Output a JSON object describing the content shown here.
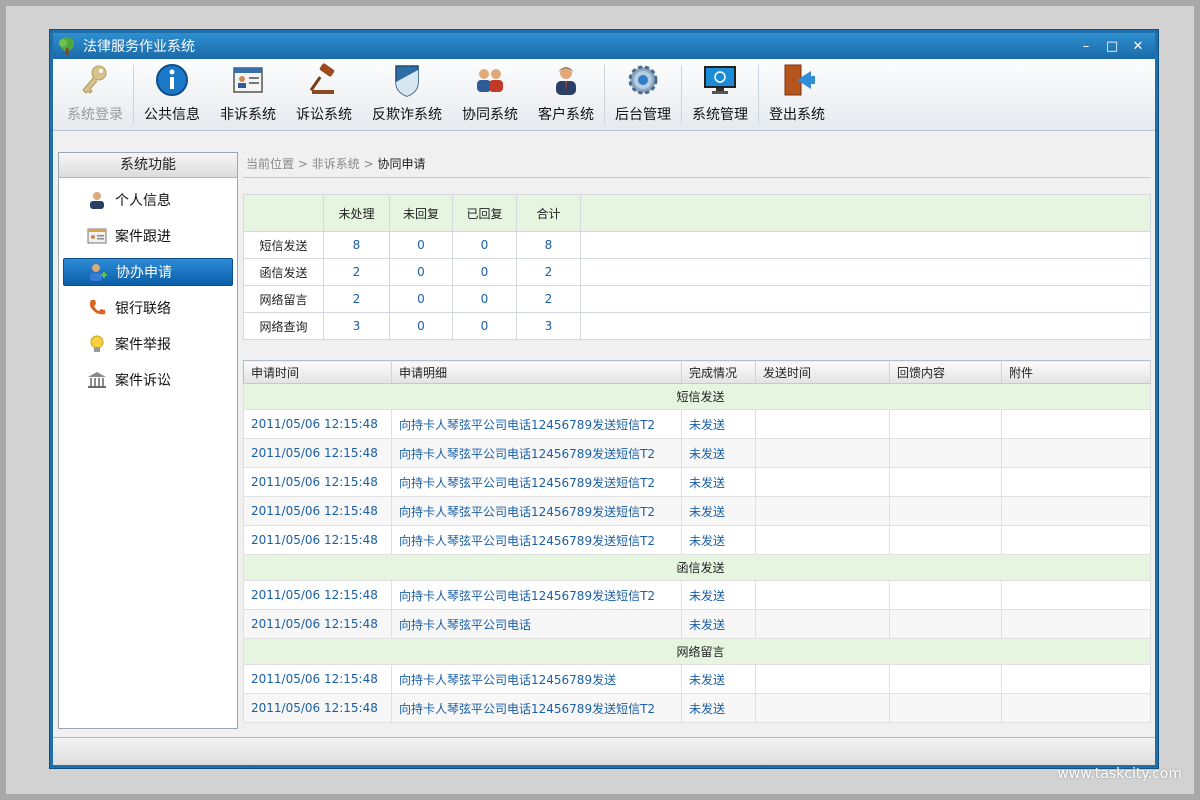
{
  "window": {
    "title": "法律服务作业系统"
  },
  "window_controls": {
    "minimize": "–",
    "maximize": "□",
    "close": "✕"
  },
  "toolbar": [
    {
      "label": "系统登录",
      "icon": "key-icon",
      "disabled": true
    },
    {
      "label": "公共信息",
      "icon": "info-icon"
    },
    {
      "label": "非诉系统",
      "icon": "id-card-icon"
    },
    {
      "label": "诉讼系统",
      "icon": "gavel-icon"
    },
    {
      "label": "反欺诈系统",
      "icon": "shield-icon"
    },
    {
      "label": "协同系统",
      "icon": "users-icon"
    },
    {
      "label": "客户系统",
      "icon": "customer-icon"
    },
    {
      "label": "后台管理",
      "icon": "gear-icon"
    },
    {
      "label": "系统管理",
      "icon": "monitor-icon"
    },
    {
      "label": "登出系统",
      "icon": "logout-icon"
    }
  ],
  "sidebar": {
    "title": "系统功能",
    "items": [
      {
        "label": "个人信息",
        "icon": "person-icon"
      },
      {
        "label": "案件跟进",
        "icon": "card-icon"
      },
      {
        "label": "协办申请",
        "icon": "user-add-icon",
        "active": true
      },
      {
        "label": "银行联络",
        "icon": "phone-icon"
      },
      {
        "label": "案件举报",
        "icon": "bulb-icon"
      },
      {
        "label": "案件诉讼",
        "icon": "court-icon"
      }
    ]
  },
  "breadcrumb": {
    "root": "当前位置",
    "sep1": ">",
    "level1": "非诉系统",
    "sep2": ">",
    "current": "协同申请"
  },
  "stats": {
    "headers": [
      "",
      "未处理",
      "未回复",
      "已回复",
      "合计"
    ],
    "rows": [
      {
        "label": "短信发送",
        "values": [
          "8",
          "0",
          "0",
          "8"
        ]
      },
      {
        "label": "函信发送",
        "values": [
          "2",
          "0",
          "0",
          "2"
        ]
      },
      {
        "label": "网络留言",
        "values": [
          "2",
          "0",
          "0",
          "2"
        ]
      },
      {
        "label": "网络查询",
        "values": [
          "3",
          "0",
          "0",
          "3"
        ]
      }
    ]
  },
  "detail": {
    "headers": [
      "申请时间",
      "申请明细",
      "完成情况",
      "发送时间",
      "回馈内容",
      "附件"
    ],
    "groups": [
      {
        "name": "短信发送",
        "rows": [
          [
            "2011/05/06 12:15:48",
            "向持卡人琴弦平公司电话12456789发送短信T2",
            "未发送"
          ],
          [
            "2011/05/06 12:15:48",
            "向持卡人琴弦平公司电话12456789发送短信T2",
            "未发送"
          ],
          [
            "2011/05/06 12:15:48",
            "向持卡人琴弦平公司电话12456789发送短信T2",
            "未发送"
          ],
          [
            "2011/05/06 12:15:48",
            "向持卡人琴弦平公司电话12456789发送短信T2",
            "未发送"
          ],
          [
            "2011/05/06 12:15:48",
            "向持卡人琴弦平公司电话12456789发送短信T2",
            "未发送"
          ]
        ]
      },
      {
        "name": "函信发送",
        "rows": [
          [
            "2011/05/06 12:15:48",
            "向持卡人琴弦平公司电话12456789发送短信T2",
            "未发送"
          ],
          [
            "2011/05/06 12:15:48",
            "向持卡人琴弦平公司电话",
            "未发送"
          ]
        ]
      },
      {
        "name": "网络留言",
        "rows": [
          [
            "2011/05/06 12:15:48",
            "向持卡人琴弦平公司电话12456789发送",
            "未发送"
          ],
          [
            "2011/05/06 12:15:48",
            "向持卡人琴弦平公司电话12456789发送短信T2",
            "未发送"
          ]
        ]
      }
    ]
  },
  "watermark": "www.taskcity.com",
  "colors": {
    "accent": "#1f6fab",
    "link": "#1a5fa6",
    "group_bg": "#e6f5e0"
  }
}
